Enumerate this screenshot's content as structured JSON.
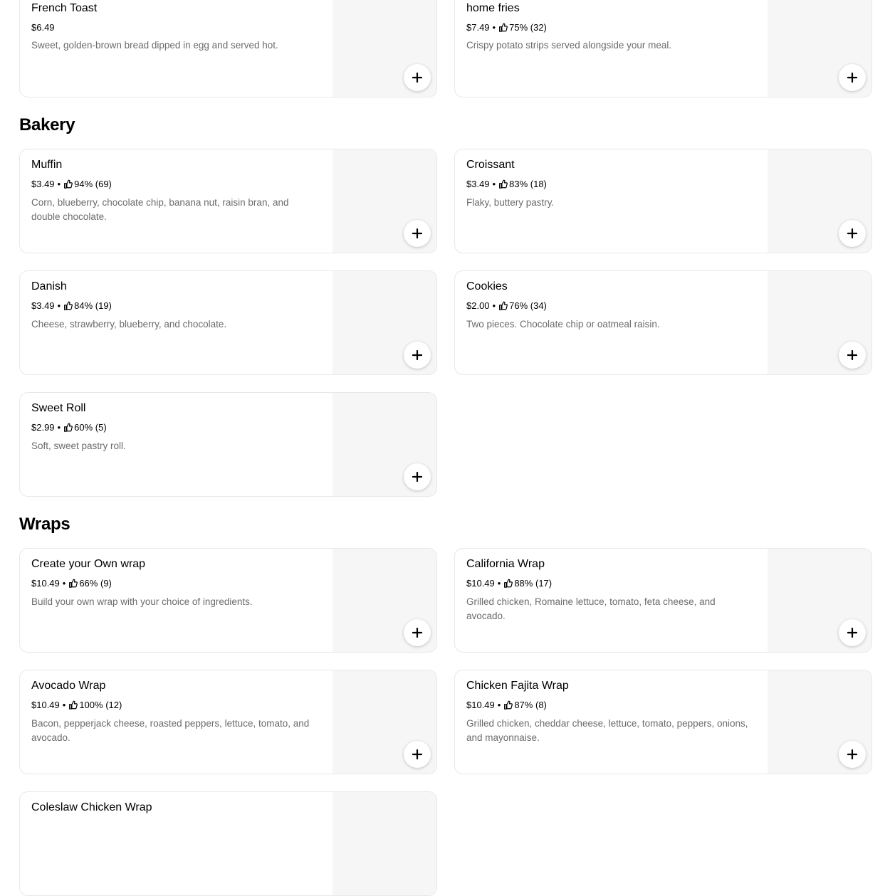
{
  "sections": [
    {
      "title": "",
      "items": [
        {
          "name": "French Toast",
          "price": "$6.49",
          "rating": "",
          "count": "",
          "description": "Sweet, golden-brown bread dipped in egg and served hot."
        },
        {
          "name": "home fries",
          "price": "$7.49",
          "rating": "75%",
          "count": "(32)",
          "description": "Crispy potato strips served alongside your meal."
        }
      ]
    },
    {
      "title": "Bakery",
      "items": [
        {
          "name": "Muffin",
          "price": "$3.49",
          "rating": "94%",
          "count": "(69)",
          "description": "Corn, blueberry, chocolate chip, banana nut, raisin bran, and double chocolate."
        },
        {
          "name": "Croissant",
          "price": "$3.49",
          "rating": "83%",
          "count": "(18)",
          "description": "Flaky, buttery pastry."
        },
        {
          "name": "Danish",
          "price": "$3.49",
          "rating": "84%",
          "count": "(19)",
          "description": "Cheese, strawberry, blueberry, and chocolate."
        },
        {
          "name": "Cookies",
          "price": "$2.00",
          "rating": "76%",
          "count": "(34)",
          "description": "Two pieces. Chocolate chip or oatmeal raisin."
        },
        {
          "name": "Sweet Roll",
          "price": "$2.99",
          "rating": "60%",
          "count": "(5)",
          "description": "Soft, sweet pastry roll."
        }
      ]
    },
    {
      "title": "Wraps",
      "items": [
        {
          "name": "Create your Own wrap",
          "price": "$10.49",
          "rating": "66%",
          "count": "(9)",
          "description": "Build your own wrap with your choice of ingredients."
        },
        {
          "name": "California Wrap",
          "price": "$10.49",
          "rating": "88%",
          "count": "(17)",
          "description": "Grilled chicken, Romaine lettuce, tomato, feta cheese, and avocado."
        },
        {
          "name": "Avocado Wrap",
          "price": "$10.49",
          "rating": "100%",
          "count": "(12)",
          "description": "Bacon, pepperjack cheese, roasted peppers, lettuce, tomato, and avocado."
        },
        {
          "name": "Chicken Fajita Wrap",
          "price": "$10.49",
          "rating": "87%",
          "count": "(8)",
          "description": "Grilled chicken, cheddar cheese, lettuce, tomato, peppers, onions, and mayonnaise."
        },
        {
          "name": "Coleslaw Chicken Wrap",
          "price": "",
          "rating": "",
          "count": "",
          "description": ""
        }
      ]
    }
  ],
  "icons": {
    "rating": "thumbs-up-icon",
    "add": "plus-icon"
  },
  "colors": {
    "card_border": "#e8e8e8",
    "image_placeholder": "#f6f6f6",
    "description_text": "#6b6b6b",
    "add_button": "#ffffff"
  }
}
